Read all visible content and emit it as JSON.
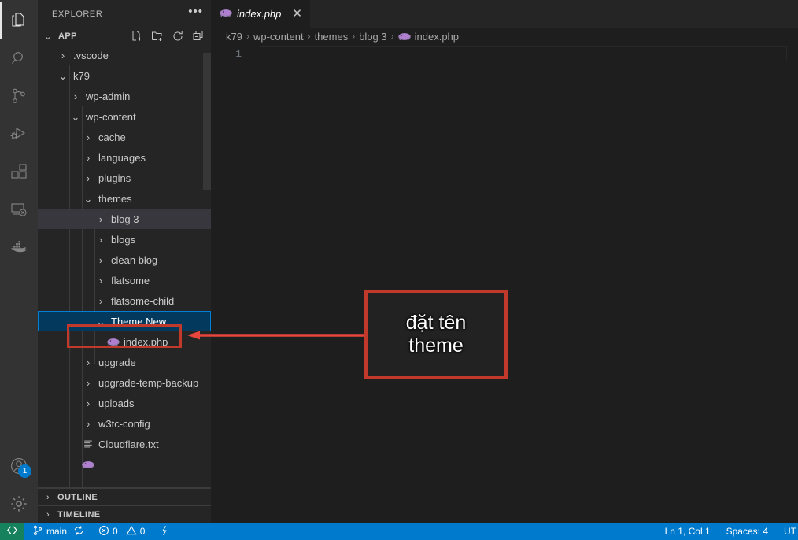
{
  "window": {
    "app": "Visual Studio Code"
  },
  "activitybar": {
    "items": [
      {
        "name": "explorer",
        "label": "Explorer",
        "icon": "files-icon",
        "active": true
      },
      {
        "name": "search",
        "label": "Search",
        "icon": "search-icon",
        "active": false
      },
      {
        "name": "source-control",
        "label": "Source Control",
        "icon": "source-control-icon",
        "active": false
      },
      {
        "name": "run-debug",
        "label": "Run and Debug",
        "icon": "run-debug-icon",
        "active": false
      },
      {
        "name": "extensions",
        "label": "Extensions",
        "icon": "extensions-icon",
        "active": false
      },
      {
        "name": "remote-explorer",
        "label": "Remote Explorer",
        "icon": "remote-explorer-icon",
        "active": false
      },
      {
        "name": "docker",
        "label": "Docker",
        "icon": "docker-icon",
        "active": false
      }
    ],
    "account": {
      "label": "Accounts",
      "icon": "account-icon",
      "badge": "1"
    },
    "settings": {
      "label": "Manage",
      "icon": "gear-icon"
    }
  },
  "sidebar": {
    "title": "EXPLORER",
    "more_label": "•••",
    "root": {
      "label": "APP",
      "twisty": "⌄",
      "actions": [
        {
          "name": "new-file-button",
          "label": "New File"
        },
        {
          "name": "new-folder-button",
          "label": "New Folder"
        },
        {
          "name": "refresh-button",
          "label": "Refresh Explorer"
        },
        {
          "name": "collapse-all-button",
          "label": "Collapse Folders in Explorer"
        }
      ]
    },
    "tree": [
      {
        "label": ".vscode",
        "depth": 1,
        "type": "folder",
        "state": "collapsed",
        "selected": "none"
      },
      {
        "label": "k79",
        "depth": 1,
        "type": "folder",
        "state": "expanded",
        "selected": "none"
      },
      {
        "label": "wp-admin",
        "depth": 2,
        "type": "folder",
        "state": "collapsed",
        "selected": "none"
      },
      {
        "label": "wp-content",
        "depth": 2,
        "type": "folder",
        "state": "expanded",
        "selected": "none"
      },
      {
        "label": "cache",
        "depth": 3,
        "type": "folder",
        "state": "collapsed",
        "selected": "none"
      },
      {
        "label": "languages",
        "depth": 3,
        "type": "folder",
        "state": "collapsed",
        "selected": "none"
      },
      {
        "label": "plugins",
        "depth": 3,
        "type": "folder",
        "state": "collapsed",
        "selected": "none"
      },
      {
        "label": "themes",
        "depth": 3,
        "type": "folder",
        "state": "expanded",
        "selected": "none"
      },
      {
        "label": "blog 3",
        "depth": 4,
        "type": "folder",
        "state": "collapsed",
        "selected": "inactive"
      },
      {
        "label": "blogs",
        "depth": 4,
        "type": "folder",
        "state": "collapsed",
        "selected": "none"
      },
      {
        "label": "clean blog",
        "depth": 4,
        "type": "folder",
        "state": "collapsed",
        "selected": "none"
      },
      {
        "label": "flatsome",
        "depth": 4,
        "type": "folder",
        "state": "collapsed",
        "selected": "none"
      },
      {
        "label": "flatsome-child",
        "depth": 4,
        "type": "folder",
        "state": "collapsed",
        "selected": "none"
      },
      {
        "label": "Theme New",
        "depth": 4,
        "type": "folder",
        "state": "expanded",
        "selected": "active"
      },
      {
        "label": "index.php",
        "depth": 5,
        "type": "php",
        "state": "file",
        "selected": "none"
      },
      {
        "label": "upgrade",
        "depth": 3,
        "type": "folder",
        "state": "collapsed",
        "selected": "none"
      },
      {
        "label": "upgrade-temp-backup",
        "depth": 3,
        "type": "folder",
        "state": "collapsed",
        "selected": "none"
      },
      {
        "label": "uploads",
        "depth": 3,
        "type": "folder",
        "state": "collapsed",
        "selected": "none"
      },
      {
        "label": "w3tc-config",
        "depth": 3,
        "type": "folder",
        "state": "collapsed",
        "selected": "none"
      },
      {
        "label": "Cloudflare.txt",
        "depth": 3,
        "type": "text",
        "state": "file",
        "selected": "none"
      }
    ],
    "panels": [
      {
        "label": "OUTLINE",
        "twisty": "›"
      },
      {
        "label": "TIMELINE",
        "twisty": "›"
      }
    ]
  },
  "editor": {
    "tab": {
      "label": "index.php",
      "icon": "php-icon",
      "close": "✕",
      "preview": true
    },
    "breadcrumb": [
      {
        "label": "k79",
        "icon": "none"
      },
      {
        "label": "wp-content",
        "icon": "none"
      },
      {
        "label": "themes",
        "icon": "none"
      },
      {
        "label": "blog 3",
        "icon": "none"
      },
      {
        "label": "index.php",
        "icon": "php-icon"
      }
    ],
    "breadcrumb_separator": "›",
    "lines": [
      {
        "number": "1",
        "text": ""
      }
    ]
  },
  "statusbar": {
    "remote": {
      "icon": "remote-icon",
      "label": ""
    },
    "branch": {
      "icon": "git-branch-icon",
      "label": "main",
      "sync_icon": "sync-icon"
    },
    "problems": {
      "error_icon": "error-icon",
      "errors": "0",
      "warning_icon": "warning-icon",
      "warnings": "0"
    },
    "ports": {
      "icon": "radio-tower-icon"
    },
    "cursor": "Ln 1, Col 1",
    "indentation": "Spaces: 4",
    "encoding": "UT"
  },
  "annotation": {
    "text_line1": "đặt tên",
    "text_line2": "theme",
    "border_color": "#C0392B",
    "text_color": "#FFFFFF",
    "arrow": "points-left-to-theme-new-row"
  },
  "colors": {
    "accent_statusbar": "#007ACC",
    "selection_active": "#04395E",
    "selection_focus_border": "#007FD4",
    "selection_inactive": "#37373D",
    "sidebar_bg": "#252526",
    "editor_bg": "#1E1E1E",
    "activitybar_bg": "#333333",
    "remote_green": "#16825D"
  }
}
